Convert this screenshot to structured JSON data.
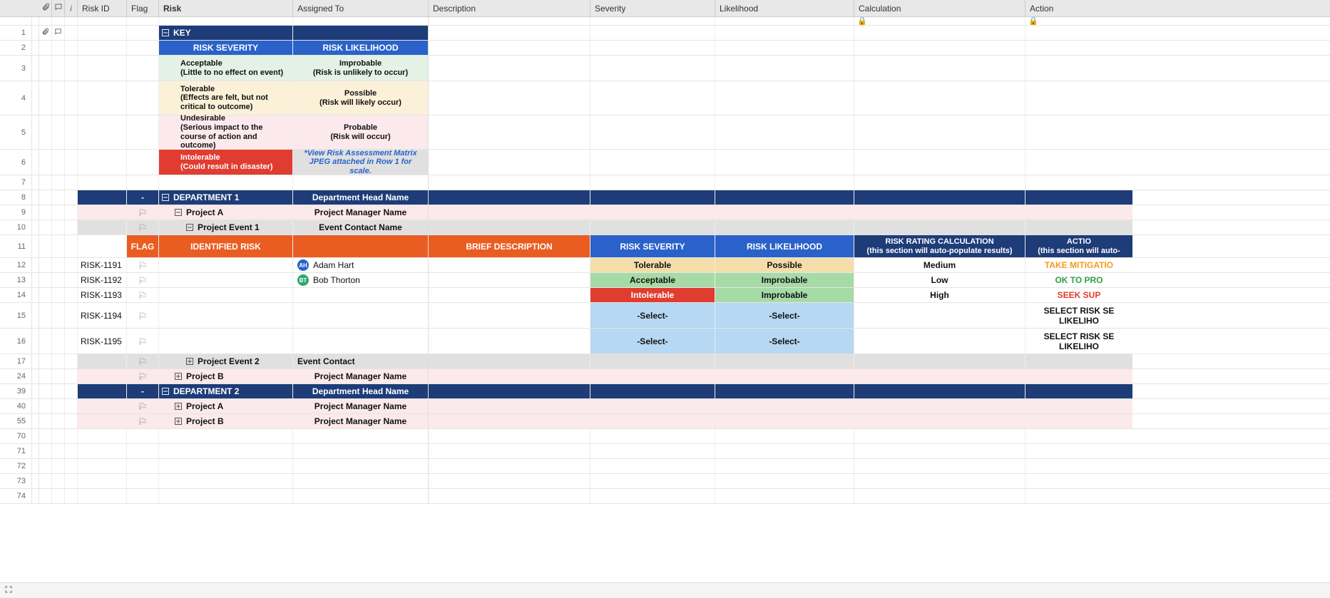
{
  "columns": {
    "attach_icon": "attach",
    "comment_icon": "comment",
    "info_icon": "i",
    "risk_id": "Risk ID",
    "flag": "Flag",
    "risk": "Risk",
    "assigned_to": "Assigned To",
    "description": "Description",
    "severity": "Severity",
    "likelihood": "Likelihood",
    "calculation": "Calculation",
    "action": "Action"
  },
  "lock_icon_rows": [
    "calculation",
    "action"
  ],
  "row_numbers": [
    "1",
    "2",
    "3",
    "4",
    "5",
    "6",
    "7",
    "8",
    "9",
    "10",
    "11",
    "12",
    "13",
    "14",
    "15",
    "16",
    "17",
    "24",
    "39",
    "40",
    "55",
    "70",
    "71",
    "72",
    "73",
    "74"
  ],
  "key": {
    "title": "KEY",
    "severity_hdr": "RISK SEVERITY",
    "likelihood_hdr": "RISK LIKELIHOOD",
    "rows": [
      {
        "sev_title": "Acceptable",
        "sev_sub": "(Little to no effect on event)",
        "like_title": "Improbable",
        "like_sub": "(Risk is unlikely to occur)",
        "sev_bg": "bg-mint",
        "like_bg": "bg-mint"
      },
      {
        "sev_title": "Tolerable",
        "sev_sub": "(Effects are felt, but not critical to outcome)",
        "like_title": "Possible",
        "like_sub": "(Risk will likely occur)",
        "sev_bg": "bg-cream",
        "like_bg": "bg-cream"
      },
      {
        "sev_title": "Undesirable",
        "sev_sub": "(Serious impact to the course of action and outcome)",
        "like_title": "Probable",
        "like_sub": "(Risk will occur)",
        "sev_bg": "bg-pink",
        "like_bg": "bg-pink"
      },
      {
        "sev_title": "Intolerable",
        "sev_sub": "(Could result in disaster)",
        "like_title": "*View Risk Assessment Matrix JPEG attached in Row 1 for scale.",
        "like_sub": "",
        "sev_bg": "bg-red",
        "like_bg": "bg-ltgray",
        "like_italic": true
      }
    ]
  },
  "dept1": {
    "dash": "-",
    "title": "DEPARTMENT 1",
    "head": "Department Head Name",
    "projectA": {
      "title": "Project A",
      "mgr": "Project Manager Name"
    },
    "event1": {
      "title": "Project Event 1",
      "contact": "Event Contact Name"
    },
    "event2": {
      "title": "Project Event 2",
      "contact": "Event Contact"
    },
    "projectB": {
      "title": "Project B",
      "mgr": "Project Manager Name"
    }
  },
  "dept2": {
    "dash": "-",
    "title": "DEPARTMENT 2",
    "head": "Department Head Name",
    "projectA": {
      "title": "Project A",
      "mgr": "Project Manager Name"
    },
    "projectB": {
      "title": "Project B",
      "mgr": "Project Manager Name"
    }
  },
  "section_hdr": {
    "flag": "FLAG",
    "risk": "IDENTIFIED RISK",
    "desc": "BRIEF DESCRIPTION",
    "sev": "RISK SEVERITY",
    "like": "RISK LIKELIHOOD",
    "calc_l1": "RISK RATING CALCULATION",
    "calc_l2": "(this section will auto-populate results)",
    "action_l1": "ACTIO",
    "action_l2": "(this section will auto-"
  },
  "risks": [
    {
      "id": "RISK-1191",
      "assignee": "Adam Hart",
      "initials": "AH",
      "av": "av-blue",
      "sev": "Tolerable",
      "sev_bg": "bg-tan",
      "like": "Possible",
      "like_bg": "bg-tan",
      "calc": "Medium",
      "action": "TAKE MITIGATIO",
      "action_cls": "txt-orange"
    },
    {
      "id": "RISK-1192",
      "assignee": "Bob Thorton",
      "initials": "BT",
      "av": "av-green",
      "sev": "Acceptable",
      "sev_bg": "bg-green",
      "like": "Improbable",
      "like_bg": "bg-green",
      "calc": "Low",
      "action": "OK TO PRO",
      "action_cls": "txt-green"
    },
    {
      "id": "RISK-1193",
      "assignee": "",
      "initials": "",
      "av": "",
      "sev": "Intolerable",
      "sev_bg": "bg-red",
      "like": "Improbable",
      "like_bg": "bg-green",
      "calc": "High",
      "action": "SEEK SUP",
      "action_cls": "txt-red"
    },
    {
      "id": "RISK-1194",
      "assignee": "",
      "initials": "",
      "av": "",
      "sev": "-Select-",
      "sev_bg": "bg-lblue",
      "like": "-Select-",
      "like_bg": "bg-lblue",
      "calc": "",
      "action": "SELECT RISK SE LIKELIHO",
      "action_cls": "bold",
      "tall": true
    },
    {
      "id": "RISK-1195",
      "assignee": "",
      "initials": "",
      "av": "",
      "sev": "-Select-",
      "sev_bg": "bg-lblue",
      "like": "-Select-",
      "like_bg": "bg-lblue",
      "calc": "",
      "action": "SELECT RISK SE LIKELIHO",
      "action_cls": "bold",
      "tall": true
    }
  ]
}
